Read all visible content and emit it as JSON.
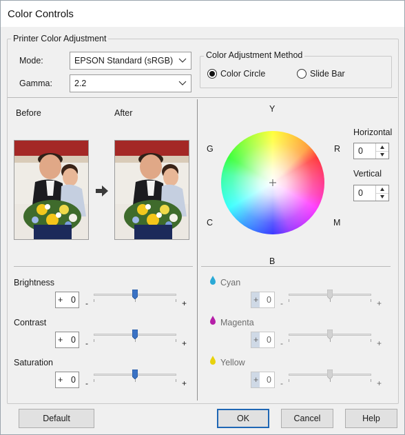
{
  "window": {
    "title": "Color Controls"
  },
  "printer_color_adjustment": {
    "label": "Printer Color Adjustment",
    "mode_label": "Mode:",
    "mode_value": "EPSON Standard (sRGB)",
    "gamma_label": "Gamma:",
    "gamma_value": "2.2"
  },
  "color_adjustment_method": {
    "label": "Color Adjustment Method",
    "options": [
      {
        "label": "Color Circle",
        "selected": true
      },
      {
        "label": "Slide Bar",
        "selected": false
      }
    ]
  },
  "preview": {
    "before_label": "Before",
    "after_label": "After"
  },
  "color_circle": {
    "labels": {
      "y": "Y",
      "g": "G",
      "r": "R",
      "c": "C",
      "m": "M",
      "b": "B"
    },
    "horizontal_label": "Horizontal",
    "horizontal_value": "0",
    "vertical_label": "Vertical",
    "vertical_value": "0"
  },
  "sliders": [
    {
      "label": "Brightness",
      "sign": "+",
      "value": "0",
      "minus": "-",
      "plus": "+",
      "level": 0.5,
      "enabled": true
    },
    {
      "label": "Contrast",
      "sign": "+",
      "value": "0",
      "minus": "-",
      "plus": "+",
      "level": 0.5,
      "enabled": true
    },
    {
      "label": "Saturation",
      "sign": "+",
      "value": "0",
      "minus": "-",
      "plus": "+",
      "level": 0.5,
      "enabled": true
    }
  ],
  "ink_sliders": [
    {
      "label": "Cyan",
      "sign": "+",
      "value": "0",
      "minus": "-",
      "plus": "+",
      "level": 0.5,
      "enabled": false,
      "color": "#2aa9d6"
    },
    {
      "label": "Magenta",
      "sign": "+",
      "value": "0",
      "minus": "-",
      "plus": "+",
      "level": 0.5,
      "enabled": false,
      "color": "#b51fa8"
    },
    {
      "label": "Yellow",
      "sign": "+",
      "value": "0",
      "minus": "-",
      "plus": "+",
      "level": 0.5,
      "enabled": false,
      "color": "#e8d20c"
    }
  ],
  "buttons": {
    "default": "Default",
    "ok": "OK",
    "cancel": "Cancel",
    "help": "Help"
  },
  "colors": {
    "accent": "#1e66b4",
    "thumb": "#3a72c4",
    "window_bg": "#f0f0f0"
  }
}
